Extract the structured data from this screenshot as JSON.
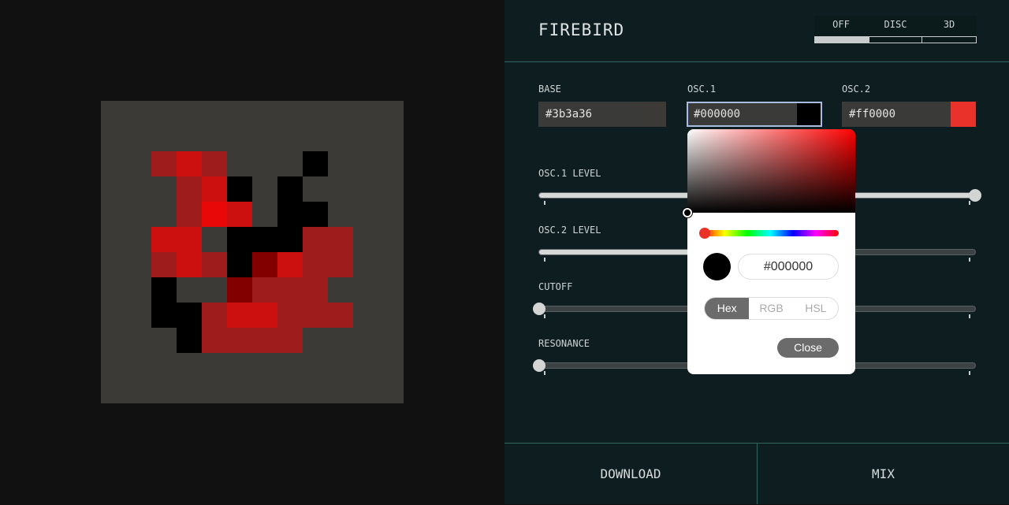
{
  "palette": {
    "G": "#3b3a36",
    "A": "#9e1c1c",
    "B": "#cc1010",
    "C": "#e80808",
    "D": "#820000",
    "K": "#000000"
  },
  "art_rows": [
    "GGGGGGGGGGGG",
    "GGGGGGGGGGGG",
    "GGABAGGGKGGG",
    "GGGABKGKGGGG",
    "GGGACBGKKGGG",
    "GGBBGKKKAAGG",
    "GGABAKDBAAGG",
    "GGKGGDAAAGGG",
    "GGKKABBAAAGG",
    "GGGKAAAAGGGG",
    "GGGGGGGGGGGG",
    "GGGGGGGGGGGG"
  ],
  "header": {
    "title": "FIREBIRD",
    "modes": [
      {
        "label": "OFF",
        "active": true
      },
      {
        "label": "DISC",
        "active": false
      },
      {
        "label": "3D",
        "active": false
      }
    ]
  },
  "colors": {
    "base": {
      "label": "BASE",
      "value": "#3b3a36"
    },
    "osc1": {
      "label": "OSC.1",
      "value": "#000000"
    },
    "osc2": {
      "label": "OSC.2",
      "value": "#ff0000",
      "swatch": "#e8322a"
    }
  },
  "sliders": [
    {
      "label": "OSC.1 LEVEL",
      "value": 1.0
    },
    {
      "label": "OSC.2 LEVEL",
      "value": 0.5
    },
    {
      "label": "CUTOFF",
      "value": 0.0
    },
    {
      "label": "RESONANCE",
      "value": 0.0
    }
  ],
  "picker": {
    "hex": "#000000",
    "formats": [
      "Hex",
      "RGB",
      "HSL"
    ],
    "active_format": "Hex",
    "close_label": "Close"
  },
  "footer": {
    "download_label": "DOWNLOAD",
    "mix_label": "MIX"
  }
}
